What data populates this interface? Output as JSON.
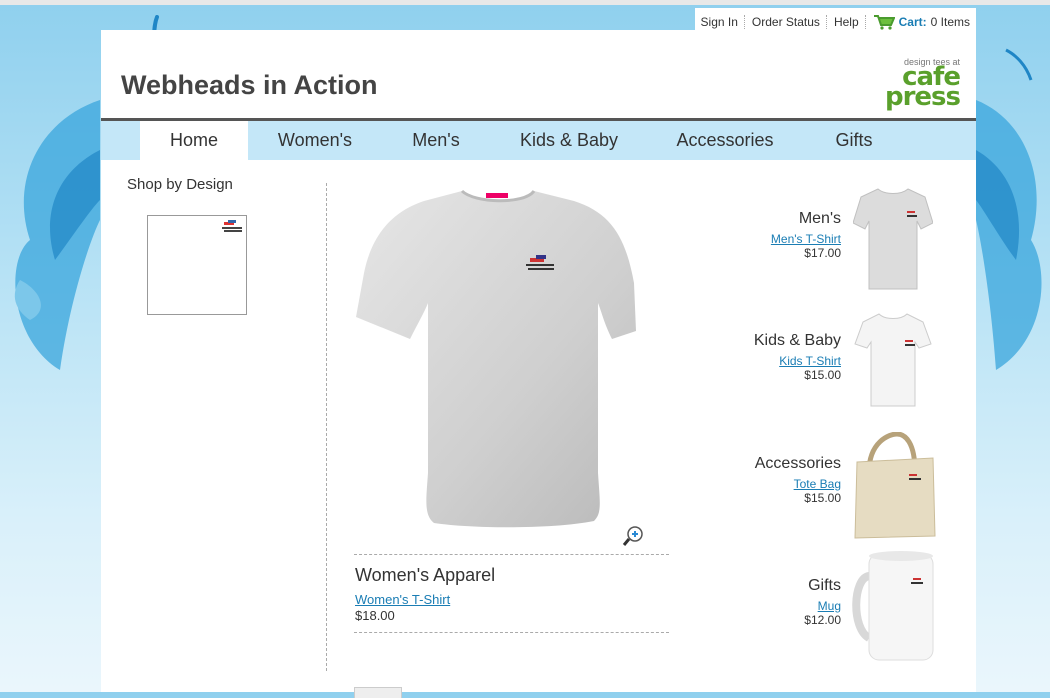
{
  "topbar": {
    "sign_in": "Sign In",
    "order_status": "Order Status",
    "help": "Help",
    "cart_label": "Cart:",
    "cart_count": "0 Items"
  },
  "store": {
    "title": "Webheads in Action"
  },
  "logo": {
    "tagline": "design tees at",
    "line1": "cafe",
    "line2": "press"
  },
  "nav": [
    "Home",
    "Women's",
    "Men's",
    "Kids & Baby",
    "Accessories",
    "Gifts"
  ],
  "sidebar": {
    "heading": "Shop by Design"
  },
  "featured": {
    "category": "Women's Apparel",
    "link": "Women's T-Shirt",
    "price": "$18.00"
  },
  "products": [
    {
      "category": "Men's",
      "link": "Men's T-Shirt",
      "price": "$17.00",
      "icon": "mens-tshirt-image"
    },
    {
      "category": "Kids & Baby",
      "link": "Kids T-Shirt",
      "price": "$15.00",
      "icon": "kids-tshirt-image"
    },
    {
      "category": "Accessories",
      "link": "Tote Bag",
      "price": "$15.00",
      "icon": "tote-bag-image"
    },
    {
      "category": "Gifts",
      "link": "Mug",
      "price": "$12.00",
      "icon": "mug-image"
    }
  ],
  "colors": {
    "link": "#1a7db4",
    "nav_bg": "#c4e7f8",
    "brand_green": "#5aa02c",
    "sky": "#8fd0ee"
  }
}
